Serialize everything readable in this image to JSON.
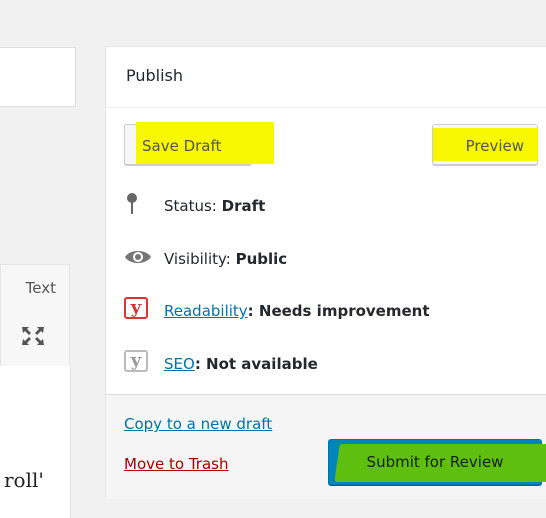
{
  "editor": {
    "text_tab": "Text",
    "snippet": "roll'"
  },
  "publish": {
    "title": "Publish",
    "save_draft": "Save Draft",
    "preview": "Preview",
    "status_label": "Status: ",
    "status_value": "Draft",
    "visibility_label": "Visibility: ",
    "visibility_value": "Public",
    "readability_link": "Readability",
    "readability_value": ": Needs improvement",
    "seo_link": "SEO",
    "seo_value": ": Not available",
    "copy_link": "Copy to a new draft",
    "trash_link": "Move to Trash",
    "submit": "Submit for Review"
  },
  "icons": {
    "status": "pin-icon",
    "visibility": "eye-icon",
    "readability": "yoast-readability-icon",
    "seo": "yoast-seo-icon",
    "yoast_glyph": "y"
  },
  "colors": {
    "highlight_yellow": "#f6f700",
    "highlight_green": "#5fbf0e",
    "primary_button": "#0085ba",
    "link": "#0073aa",
    "trash": "#aa0000",
    "readability_bad": "#dc3232"
  }
}
